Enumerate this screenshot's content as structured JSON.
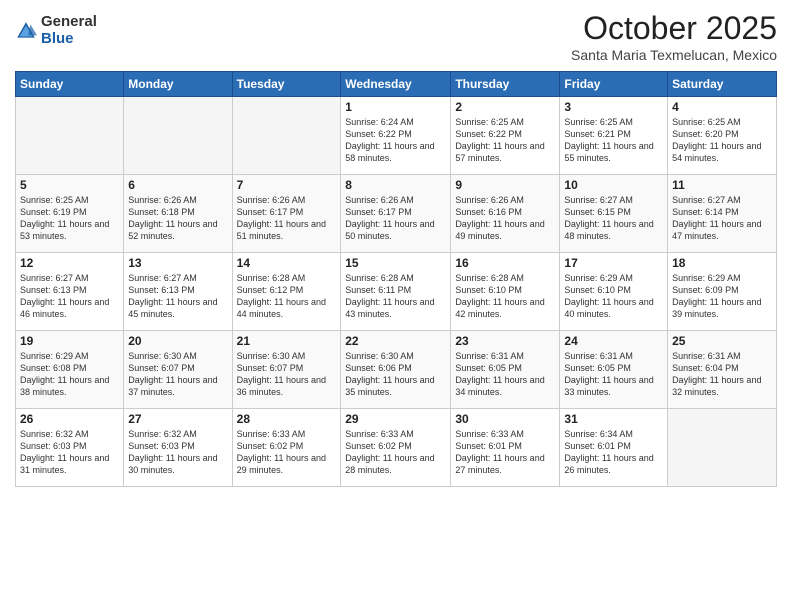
{
  "header": {
    "logo_general": "General",
    "logo_blue": "Blue",
    "month_title": "October 2025",
    "location": "Santa Maria Texmelucan, Mexico"
  },
  "weekdays": [
    "Sunday",
    "Monday",
    "Tuesday",
    "Wednesday",
    "Thursday",
    "Friday",
    "Saturday"
  ],
  "weeks": [
    [
      {
        "day": "",
        "empty": true
      },
      {
        "day": "",
        "empty": true
      },
      {
        "day": "",
        "empty": true
      },
      {
        "day": "1",
        "sunrise": "6:24 AM",
        "sunset": "6:22 PM",
        "daylight": "11 hours and 58 minutes."
      },
      {
        "day": "2",
        "sunrise": "6:25 AM",
        "sunset": "6:22 PM",
        "daylight": "11 hours and 57 minutes."
      },
      {
        "day": "3",
        "sunrise": "6:25 AM",
        "sunset": "6:21 PM",
        "daylight": "11 hours and 55 minutes."
      },
      {
        "day": "4",
        "sunrise": "6:25 AM",
        "sunset": "6:20 PM",
        "daylight": "11 hours and 54 minutes."
      }
    ],
    [
      {
        "day": "5",
        "sunrise": "6:25 AM",
        "sunset": "6:19 PM",
        "daylight": "11 hours and 53 minutes."
      },
      {
        "day": "6",
        "sunrise": "6:26 AM",
        "sunset": "6:18 PM",
        "daylight": "11 hours and 52 minutes."
      },
      {
        "day": "7",
        "sunrise": "6:26 AM",
        "sunset": "6:17 PM",
        "daylight": "11 hours and 51 minutes."
      },
      {
        "day": "8",
        "sunrise": "6:26 AM",
        "sunset": "6:17 PM",
        "daylight": "11 hours and 50 minutes."
      },
      {
        "day": "9",
        "sunrise": "6:26 AM",
        "sunset": "6:16 PM",
        "daylight": "11 hours and 49 minutes."
      },
      {
        "day": "10",
        "sunrise": "6:27 AM",
        "sunset": "6:15 PM",
        "daylight": "11 hours and 48 minutes."
      },
      {
        "day": "11",
        "sunrise": "6:27 AM",
        "sunset": "6:14 PM",
        "daylight": "11 hours and 47 minutes."
      }
    ],
    [
      {
        "day": "12",
        "sunrise": "6:27 AM",
        "sunset": "6:13 PM",
        "daylight": "11 hours and 46 minutes."
      },
      {
        "day": "13",
        "sunrise": "6:27 AM",
        "sunset": "6:13 PM",
        "daylight": "11 hours and 45 minutes."
      },
      {
        "day": "14",
        "sunrise": "6:28 AM",
        "sunset": "6:12 PM",
        "daylight": "11 hours and 44 minutes."
      },
      {
        "day": "15",
        "sunrise": "6:28 AM",
        "sunset": "6:11 PM",
        "daylight": "11 hours and 43 minutes."
      },
      {
        "day": "16",
        "sunrise": "6:28 AM",
        "sunset": "6:10 PM",
        "daylight": "11 hours and 42 minutes."
      },
      {
        "day": "17",
        "sunrise": "6:29 AM",
        "sunset": "6:10 PM",
        "daylight": "11 hours and 40 minutes."
      },
      {
        "day": "18",
        "sunrise": "6:29 AM",
        "sunset": "6:09 PM",
        "daylight": "11 hours and 39 minutes."
      }
    ],
    [
      {
        "day": "19",
        "sunrise": "6:29 AM",
        "sunset": "6:08 PM",
        "daylight": "11 hours and 38 minutes."
      },
      {
        "day": "20",
        "sunrise": "6:30 AM",
        "sunset": "6:07 PM",
        "daylight": "11 hours and 37 minutes."
      },
      {
        "day": "21",
        "sunrise": "6:30 AM",
        "sunset": "6:07 PM",
        "daylight": "11 hours and 36 minutes."
      },
      {
        "day": "22",
        "sunrise": "6:30 AM",
        "sunset": "6:06 PM",
        "daylight": "11 hours and 35 minutes."
      },
      {
        "day": "23",
        "sunrise": "6:31 AM",
        "sunset": "6:05 PM",
        "daylight": "11 hours and 34 minutes."
      },
      {
        "day": "24",
        "sunrise": "6:31 AM",
        "sunset": "6:05 PM",
        "daylight": "11 hours and 33 minutes."
      },
      {
        "day": "25",
        "sunrise": "6:31 AM",
        "sunset": "6:04 PM",
        "daylight": "11 hours and 32 minutes."
      }
    ],
    [
      {
        "day": "26",
        "sunrise": "6:32 AM",
        "sunset": "6:03 PM",
        "daylight": "11 hours and 31 minutes."
      },
      {
        "day": "27",
        "sunrise": "6:32 AM",
        "sunset": "6:03 PM",
        "daylight": "11 hours and 30 minutes."
      },
      {
        "day": "28",
        "sunrise": "6:33 AM",
        "sunset": "6:02 PM",
        "daylight": "11 hours and 29 minutes."
      },
      {
        "day": "29",
        "sunrise": "6:33 AM",
        "sunset": "6:02 PM",
        "daylight": "11 hours and 28 minutes."
      },
      {
        "day": "30",
        "sunrise": "6:33 AM",
        "sunset": "6:01 PM",
        "daylight": "11 hours and 27 minutes."
      },
      {
        "day": "31",
        "sunrise": "6:34 AM",
        "sunset": "6:01 PM",
        "daylight": "11 hours and 26 minutes."
      },
      {
        "day": "",
        "empty": true
      }
    ]
  ]
}
